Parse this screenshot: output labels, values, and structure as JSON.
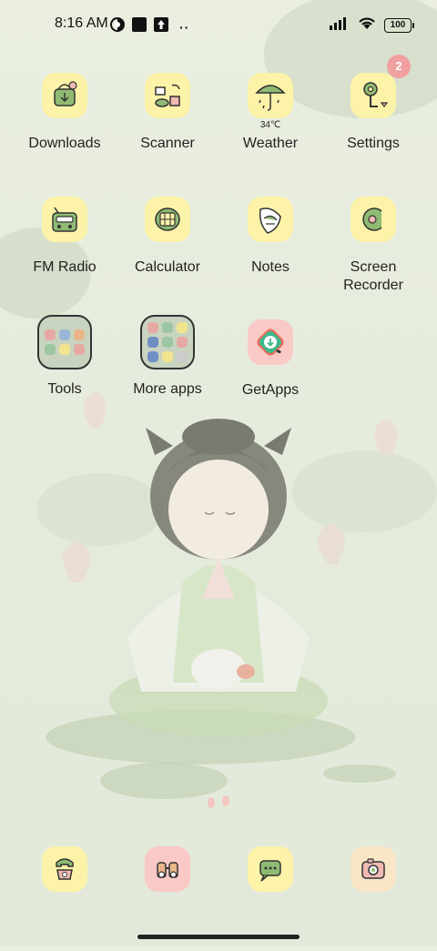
{
  "status_bar": {
    "time": "8:16 AM",
    "more_dots": "··",
    "battery": "100"
  },
  "apps": [
    {
      "label": "Downloads"
    },
    {
      "label": "Scanner"
    },
    {
      "label": "Weather",
      "sublabel": "34℃"
    },
    {
      "label": "Settings",
      "badge": "2"
    },
    {
      "label": "FM Radio"
    },
    {
      "label": "Calculator"
    },
    {
      "label": "Notes"
    },
    {
      "label": "Screen Recorder"
    },
    {
      "label": "Tools"
    },
    {
      "label": "More apps"
    },
    {
      "label": "GetApps"
    }
  ],
  "dock": [
    {
      "icon": "phone-icon"
    },
    {
      "icon": "camera-icon"
    },
    {
      "icon": "messages-icon"
    },
    {
      "icon": "gallery-camera-icon"
    }
  ],
  "colors": {
    "icon_yellow": "#fcf3a9",
    "icon_pink": "#f9c9c6",
    "badge": "#f1a0a0",
    "wallpaper": "#e6ecdd"
  }
}
